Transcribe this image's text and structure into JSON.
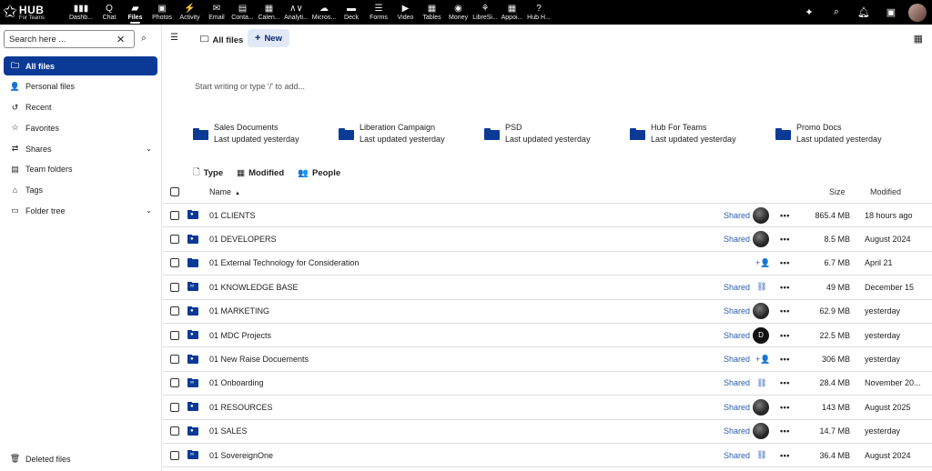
{
  "topbar": {
    "logo_main": "HUB",
    "logo_sub": "For Teams",
    "apps": [
      {
        "label": "Dashb...",
        "icon": "dashboard-icon",
        "glyph": "▮▮▮",
        "active": false,
        "width": 34
      },
      {
        "label": "Chat",
        "icon": "chat-icon",
        "glyph": "Q",
        "active": false,
        "width": 28
      },
      {
        "label": "Files",
        "icon": "folder-icon",
        "glyph": "▰",
        "active": true,
        "width": 29
      },
      {
        "label": "Photos",
        "icon": "photos-icon",
        "glyph": "▣",
        "active": false,
        "width": 30
      },
      {
        "label": "Activity",
        "icon": "activity-icon",
        "glyph": "⚡",
        "active": false,
        "width": 31
      },
      {
        "label": "Email",
        "icon": "email-icon",
        "glyph": "✉",
        "active": false,
        "width": 28
      },
      {
        "label": "Conta...",
        "icon": "contacts-icon",
        "glyph": "▤",
        "active": false,
        "width": 29
      },
      {
        "label": "Calen...",
        "icon": "calendar-icon",
        "glyph": "▦",
        "active": false,
        "width": 29
      },
      {
        "label": "Analyti...",
        "icon": "analytics-icon",
        "glyph": "∧∨",
        "active": false,
        "width": 31
      },
      {
        "label": "Micros...",
        "icon": "microsoft-icon",
        "glyph": "☁",
        "active": false,
        "width": 30
      },
      {
        "label": "Deck",
        "icon": "deck-icon",
        "glyph": "▬",
        "active": false,
        "width": 30
      },
      {
        "label": "Forms",
        "icon": "forms-icon",
        "glyph": "☰",
        "active": false,
        "width": 30
      },
      {
        "label": "Video",
        "icon": "video-icon",
        "glyph": "▶",
        "active": false,
        "width": 29
      },
      {
        "label": "Tables",
        "icon": "tables-icon",
        "glyph": "▦",
        "active": false,
        "width": 29
      },
      {
        "label": "Money",
        "icon": "money-icon",
        "glyph": "◉",
        "active": false,
        "width": 29
      },
      {
        "label": "LibreSi...",
        "icon": "libresign-icon",
        "glyph": "⚘",
        "active": false,
        "width": 30
      },
      {
        "label": "Appoi...",
        "icon": "appointments-icon",
        "glyph": "▦",
        "active": false,
        "width": 29
      },
      {
        "label": "Hub H...",
        "icon": "help-icon",
        "glyph": "?",
        "active": false,
        "width": 30
      }
    ]
  },
  "sidebar": {
    "search_placeholder": "Search here ...",
    "items": [
      {
        "label": "All files",
        "icon": "folder-icon",
        "glyph": "🗀",
        "active": true,
        "chevron": false
      },
      {
        "label": "Personal files",
        "icon": "person-icon",
        "glyph": "👤",
        "active": false,
        "chevron": false
      },
      {
        "label": "Recent",
        "icon": "history-icon",
        "glyph": "↺",
        "active": false,
        "chevron": false
      },
      {
        "label": "Favorites",
        "icon": "star-icon",
        "glyph": "☆",
        "active": false,
        "chevron": false
      },
      {
        "label": "Shares",
        "icon": "share-icon",
        "glyph": "⇄",
        "active": false,
        "chevron": true
      },
      {
        "label": "Team folders",
        "icon": "team-folder-icon",
        "glyph": "▤",
        "active": false,
        "chevron": false
      },
      {
        "label": "Tags",
        "icon": "tag-icon",
        "glyph": "⌂",
        "active": false,
        "chevron": false
      },
      {
        "label": "Folder tree",
        "icon": "folder-tree-icon",
        "glyph": "▭",
        "active": false,
        "chevron": true
      }
    ],
    "deleted_label": "Deleted files"
  },
  "header": {
    "breadcrumb": "All files",
    "new_label": "New"
  },
  "editor_placeholder": "Start writing or type '/' to add...",
  "recent_folders": [
    {
      "name": "Sales Documents",
      "updated": "Last updated yesterday"
    },
    {
      "name": "Liberation Campaign",
      "updated": "Last updated yesterday"
    },
    {
      "name": "PSD",
      "updated": "Last updated yesterday"
    },
    {
      "name": "Hub For Teams",
      "updated": "Last updated yesterday"
    },
    {
      "name": "Promo Docs",
      "updated": "Last updated yesterday"
    }
  ],
  "filters": [
    {
      "label": "Type",
      "icon": "document-icon",
      "glyph": "🗋"
    },
    {
      "label": "Modified",
      "icon": "calendar-icon",
      "glyph": "▦"
    },
    {
      "label": "People",
      "icon": "people-icon",
      "glyph": "👥"
    }
  ],
  "table": {
    "headers": {
      "name": "Name",
      "size": "Size",
      "modified": "Modified"
    },
    "rows": [
      {
        "name": "01 CLIENTS",
        "folder_type": "shared",
        "shared": "Shared",
        "share_kind": "avatar",
        "size": "865.4 MB",
        "modified": "18 hours ago"
      },
      {
        "name": "01 DEVELOPERS",
        "folder_type": "shared",
        "shared": "Shared",
        "share_kind": "avatar",
        "size": "8.5 MB",
        "modified": "August 2024"
      },
      {
        "name": "01 External Technology for Consideration",
        "folder_type": "plain",
        "shared": "",
        "share_kind": "add-person",
        "size": "6.7 MB",
        "modified": "April 21"
      },
      {
        "name": "01 KNOWLEDGE BASE",
        "folder_type": "link",
        "shared": "Shared",
        "share_kind": "link",
        "size": "49 MB",
        "modified": "December 15"
      },
      {
        "name": "01 MARKETING",
        "folder_type": "shared",
        "shared": "Shared",
        "share_kind": "avatar",
        "size": "62.9 MB",
        "modified": "yesterday"
      },
      {
        "name": "01 MDC Projects",
        "folder_type": "shared",
        "shared": "Shared",
        "share_kind": "letter",
        "letter": "D",
        "size": "22.5 MB",
        "modified": "yesterday"
      },
      {
        "name": "01 New Raise Docuements",
        "folder_type": "shared",
        "shared": "Shared",
        "share_kind": "add-person",
        "size": "306 MB",
        "modified": "yesterday"
      },
      {
        "name": "01 Onboarding",
        "folder_type": "link",
        "shared": "Shared",
        "share_kind": "link",
        "size": "28.4 MB",
        "modified": "November 20..."
      },
      {
        "name": "01 RESOURCES",
        "folder_type": "shared",
        "shared": "Shared",
        "share_kind": "avatar",
        "size": "143 MB",
        "modified": "August 2025"
      },
      {
        "name": "01 SALES",
        "folder_type": "shared",
        "shared": "Shared",
        "share_kind": "avatar",
        "size": "14.7 MB",
        "modified": "yesterday"
      },
      {
        "name": "01 SovereignOne",
        "folder_type": "link",
        "shared": "Shared",
        "share_kind": "link",
        "size": "36.4 MB",
        "modified": "August 2024"
      }
    ]
  }
}
